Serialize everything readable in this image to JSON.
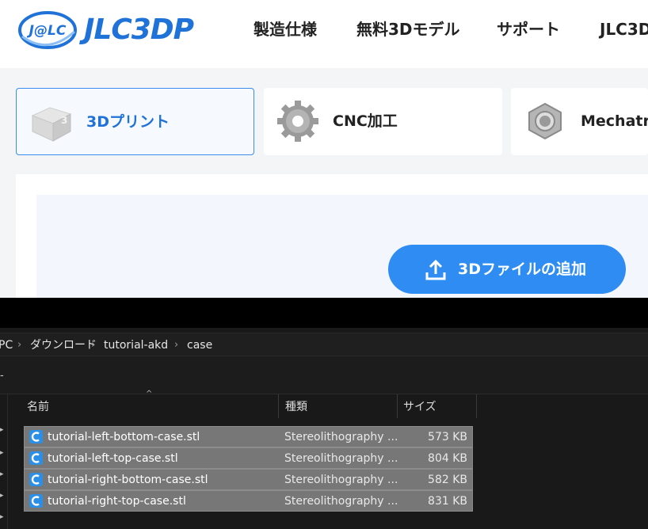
{
  "site": {
    "logo_badge": "J@LC",
    "logo_text": "JLC3DP",
    "nav": [
      "製造仕様",
      "無料3Dモデル",
      "サポート",
      "JLC3D"
    ],
    "services": [
      {
        "label": "3Dプリント",
        "icon": "3d-print-icon",
        "active": true
      },
      {
        "label": "CNC加工",
        "icon": "gear-icon",
        "active": false
      },
      {
        "label": "Mechatro",
        "icon": "hex-nut-icon",
        "active": false
      }
    ],
    "upload_button": "3Dファイルの追加",
    "brand_color": "#1f72d8",
    "button_color": "#2f8cf3"
  },
  "explorer": {
    "breadcrumb": [
      "PC",
      "ダウンロード",
      "tutorial-akd",
      "case"
    ],
    "toolbar_text": "-",
    "sort_indicator": "^",
    "columns": {
      "name": "名前",
      "type": "種類",
      "size": "サイズ"
    },
    "files": [
      {
        "name": "tutorial-left-bottom-case.stl",
        "type": "Stereolithography ...",
        "size": "573 KB"
      },
      {
        "name": "tutorial-left-top-case.stl",
        "type": "Stereolithography ...",
        "size": "804 KB"
      },
      {
        "name": "tutorial-right-bottom-case.stl",
        "type": "Stereolithography ...",
        "size": "582 KB"
      },
      {
        "name": "tutorial-right-top-case.stl",
        "type": "Stereolithography ...",
        "size": "831 KB"
      }
    ],
    "file_icon": "stl-file-icon",
    "selection_color": "#777777"
  }
}
